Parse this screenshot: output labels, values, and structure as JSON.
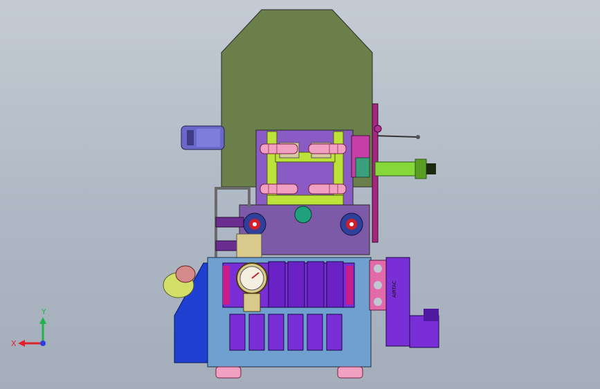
{
  "scene": {
    "background_top": "#c4cbd4",
    "background_bottom": "#a4aebb",
    "view": "front"
  },
  "model": {
    "valve_brand_text": "AIRTAC",
    "colors": {
      "hopper": "#6b7f4b",
      "manifold_base": "#6fa0cf",
      "valve_body": "#7a2fd6",
      "clamp_plate": "#7d5aa8",
      "frame_green": "#bde33a",
      "pink_roller": "#f0a0c0",
      "motor_blue": "#6a68c8",
      "cylinder_green": "#86d83a"
    }
  },
  "triad": {
    "x_label": "X",
    "y_label": "Y",
    "x_color": "#e0202a",
    "y_color": "#22b24a",
    "z_color": "#2a3fe0"
  }
}
